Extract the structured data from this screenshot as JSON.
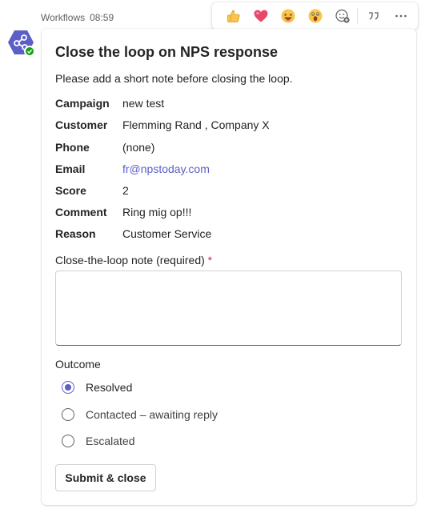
{
  "message": {
    "sender": "Workflows",
    "time": "08:59"
  },
  "reactions": {
    "items": [
      "like",
      "heart",
      "laugh",
      "surprised",
      "add-reaction"
    ],
    "more_icons": [
      "quote-reply",
      "more-options"
    ]
  },
  "card": {
    "title": "Close the loop on NPS response",
    "subtitle": "Please add a short note before closing the loop.",
    "facts": [
      {
        "key": "Campaign",
        "value": "new test"
      },
      {
        "key": "Customer",
        "value": "Flemming Rand , Company X"
      },
      {
        "key": "Phone",
        "value": "(none)"
      },
      {
        "key": "Email",
        "value": "fr@npstoday.com"
      },
      {
        "key": "Score",
        "value": "2"
      },
      {
        "key": "Comment",
        "value": "Ring mig op!!!"
      },
      {
        "key": "Reason",
        "value": "Customer Service"
      }
    ],
    "note": {
      "label": "Close-the-loop note (required)",
      "required_mark": "*",
      "value": "",
      "placeholder": ""
    },
    "outcome": {
      "label": "Outcome",
      "options": [
        {
          "label": "Resolved",
          "selected": true
        },
        {
          "label": "Contacted – awaiting reply",
          "selected": false
        },
        {
          "label": "Escalated",
          "selected": false
        }
      ]
    },
    "submit_label": "Submit & close"
  },
  "colors": {
    "accent": "#5b5fc7",
    "required": "#c4314b",
    "presence": "#13a10e"
  }
}
